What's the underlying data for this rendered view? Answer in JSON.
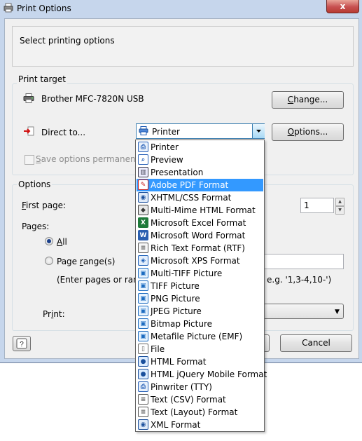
{
  "window": {
    "title": "Print Options",
    "close_glyph": "x"
  },
  "header": {
    "text": "Select printing options"
  },
  "print_target": {
    "group_label": "Print target",
    "printer_name": "Brother MFC-7820N USB",
    "change_button": "Change...",
    "direct_to_label": "Direct to...",
    "direct_to_value": "Printer",
    "options_button": "Options...",
    "save_options_label": "Save options permanently",
    "save_options_checked": false,
    "save_options_enabled": false
  },
  "options": {
    "group_label": "Options",
    "first_page_label": "First page:",
    "first_page_value": "1",
    "pages_label": "Pages:",
    "radio_all_label": "All",
    "radio_range_label": "Page range(s)",
    "selected_radio": "All",
    "range_hint_left": "(Enter pages or ranges",
    "range_hint_right": "e.g. '1,3-4,10-')",
    "print_label": "Print:"
  },
  "buttons": {
    "help": "?",
    "ok": "OK",
    "cancel": "Cancel"
  },
  "dropdown": {
    "selected_index": 3,
    "items": [
      {
        "label": "Printer",
        "icon": "printer-icon"
      },
      {
        "label": "Preview",
        "icon": "preview-icon"
      },
      {
        "label": "Presentation",
        "icon": "presentation-icon"
      },
      {
        "label": "Adobe PDF Format",
        "icon": "pdf-icon"
      },
      {
        "label": "XHTML/CSS Format",
        "icon": "xhtml-icon"
      },
      {
        "label": "Multi-Mime HTML Format",
        "icon": "mime-icon"
      },
      {
        "label": "Microsoft Excel Format",
        "icon": "excel-icon"
      },
      {
        "label": "Microsoft Word Format",
        "icon": "word-icon"
      },
      {
        "label": "Rich Text Format (RTF)",
        "icon": "rtf-icon"
      },
      {
        "label": "Microsoft XPS Format",
        "icon": "xps-icon"
      },
      {
        "label": "Multi-TIFF Picture",
        "icon": "multi-tiff-icon"
      },
      {
        "label": "TIFF Picture",
        "icon": "tiff-icon"
      },
      {
        "label": "PNG Picture",
        "icon": "png-icon"
      },
      {
        "label": "JPEG Picture",
        "icon": "jpeg-icon"
      },
      {
        "label": "Bitmap Picture",
        "icon": "bitmap-icon"
      },
      {
        "label": "Metafile Picture (EMF)",
        "icon": "emf-icon"
      },
      {
        "label": "File",
        "icon": "file-icon"
      },
      {
        "label": "HTML Format",
        "icon": "html-icon"
      },
      {
        "label": "HTML jQuery Mobile Format",
        "icon": "jquery-icon"
      },
      {
        "label": "Pinwriter (TTY)",
        "icon": "pinwriter-icon"
      },
      {
        "label": "Text (CSV) Format",
        "icon": "csv-icon"
      },
      {
        "label": "Text (Layout) Format",
        "icon": "text-layout-icon"
      },
      {
        "label": "XML Format",
        "icon": "xml-icon"
      }
    ]
  },
  "colors": {
    "selection": "#3399ff",
    "title_bar": "#c6d6ec",
    "dialog_bg": "#f0f0f0"
  }
}
